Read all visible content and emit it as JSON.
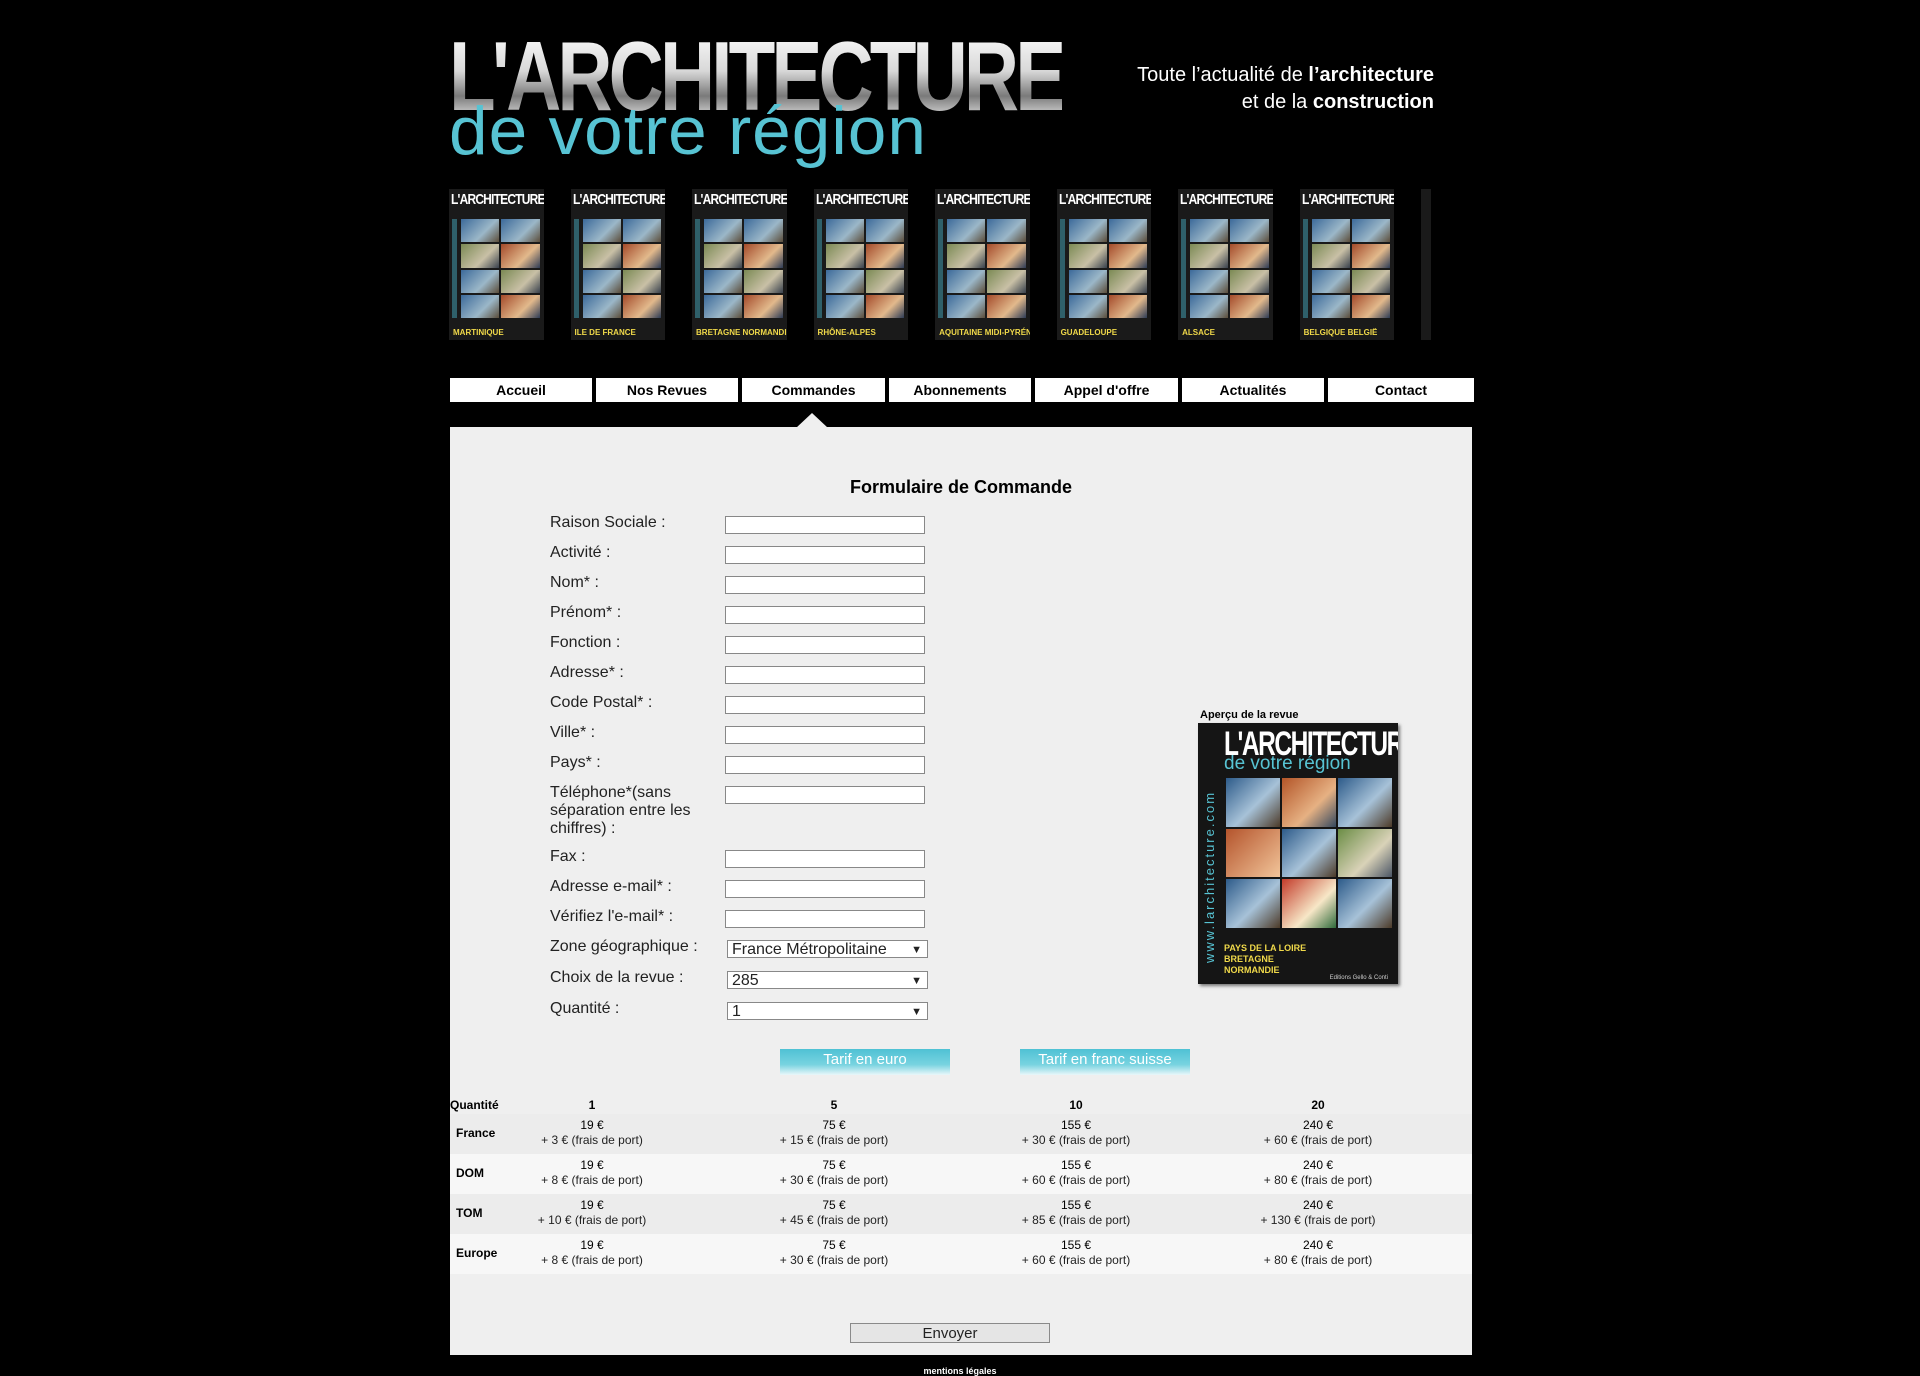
{
  "header": {
    "logo_line1": "L'ARCHITECTURE",
    "logo_line2": "de votre région",
    "tagline": {
      "part1": "Toute l’actualité de ",
      "bold1": "l’architecture",
      "part2": "et de la ",
      "bold2": "construction"
    }
  },
  "covers": [
    {
      "title": "L'ARCHITECTURE",
      "region": "MARTINIQUE"
    },
    {
      "title": "L'ARCHITECTURE",
      "region": "ILE DE FRANCE"
    },
    {
      "title": "L'ARCHITECTURE",
      "region": "BRETAGNE NORMANDIE"
    },
    {
      "title": "L'ARCHITECTURE",
      "region": "RHÔNE-ALPES"
    },
    {
      "title": "L'ARCHITECTURE",
      "region": "AQUITAINE MIDI-PYRÉNÉES"
    },
    {
      "title": "L'ARCHITECTURE",
      "region": "GUADELOUPE"
    },
    {
      "title": "L'ARCHITECTURE",
      "region": "ALSACE"
    },
    {
      "title": "L'ARCHITECTURE",
      "region": "BELGIQUE BELGIË"
    }
  ],
  "nav": {
    "items": [
      "Accueil",
      "Nos Revues",
      "Commandes",
      "Abonnements",
      "Appel d'offre",
      "Actualités",
      "Contact"
    ],
    "active": "Commandes"
  },
  "form": {
    "title": "Formulaire de Commande",
    "fields": [
      {
        "label": "Raison Sociale :",
        "value": ""
      },
      {
        "label": "Activité :",
        "value": ""
      },
      {
        "label": "Nom* :",
        "value": ""
      },
      {
        "label": "Prénom* :",
        "value": ""
      },
      {
        "label": "Fonction :",
        "value": ""
      },
      {
        "label": "Adresse* :",
        "value": ""
      },
      {
        "label": "Code Postal* :",
        "value": ""
      },
      {
        "label": "Ville* :",
        "value": ""
      },
      {
        "label": "Pays* :",
        "value": ""
      },
      {
        "label": "Téléphone*(sans séparation entre les chiffres) :",
        "value": ""
      },
      {
        "label": "Fax :",
        "value": ""
      },
      {
        "label": "Adresse e-mail* :",
        "value": ""
      },
      {
        "label": "Vérifiez l'e-mail* :",
        "value": ""
      }
    ],
    "selects": [
      {
        "label": "Zone géographique :",
        "value": "France Métropolitaine"
      },
      {
        "label": "Choix de la revue :",
        "value": "285"
      },
      {
        "label": "Quantité :",
        "value": "1"
      }
    ],
    "preview_label": "Aperçu de la revue",
    "preview": {
      "title": "L'ARCHITECTURE",
      "subtitle": "de votre région",
      "url": "www.larchitecture.com",
      "region": "PAYS DE LA LOIRE BRETAGNE NORMANDIE",
      "publisher": "Editions Gello & Conti"
    },
    "tab_euro": "Tarif en euro",
    "tab_chf": "Tarif en franc suisse",
    "submit": "Envoyer"
  },
  "price_table": {
    "header_label": "Quantité",
    "quantities": [
      "1",
      "5",
      "10",
      "20"
    ],
    "rows": [
      {
        "zone": "France",
        "cells": [
          [
            "19 €",
            "+ 3 € (frais de port)"
          ],
          [
            "75 €",
            "+ 15 € (frais de port)"
          ],
          [
            "155 €",
            "+ 30 € (frais de port)"
          ],
          [
            "240 €",
            "+ 60 € (frais de port)"
          ]
        ]
      },
      {
        "zone": "DOM",
        "cells": [
          [
            "19 €",
            "+ 8 € (frais de port)"
          ],
          [
            "75 €",
            "+ 30 € (frais de port)"
          ],
          [
            "155 €",
            "+ 60 € (frais de port)"
          ],
          [
            "240 €",
            "+ 80 € (frais de port)"
          ]
        ]
      },
      {
        "zone": "TOM",
        "cells": [
          [
            "19 €",
            "+ 10 € (frais de port)"
          ],
          [
            "75 €",
            "+ 45 € (frais de port)"
          ],
          [
            "155 €",
            "+ 85 € (frais de port)"
          ],
          [
            "240 €",
            "+ 130 € (frais de port)"
          ]
        ]
      },
      {
        "zone": "Europe",
        "cells": [
          [
            "19 €",
            "+ 8 € (frais de port)"
          ],
          [
            "75 €",
            "+ 30 € (frais de port)"
          ],
          [
            "155 €",
            "+ 60 € (frais de port)"
          ],
          [
            "240 €",
            "+ 80 € (frais de port)"
          ]
        ]
      }
    ]
  },
  "footer": {
    "legal": "mentions légales"
  },
  "colors": {
    "accent": "#57c3d3",
    "panel_bg": "#efefef",
    "page_bg": "#000000"
  }
}
